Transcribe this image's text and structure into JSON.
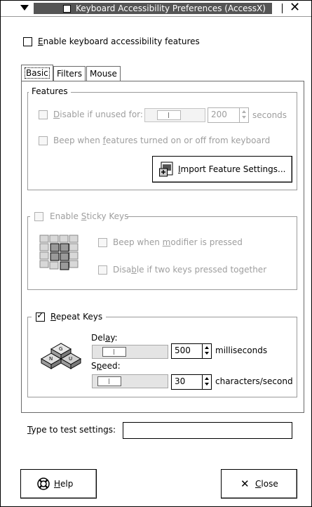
{
  "window": {
    "title": "Keyboard Accessibility Preferences (AccessX)",
    "menu_icon": "window-menu-arrow-icon",
    "close_icon": "close-x-icon"
  },
  "main": {
    "enable_label_mn": "E",
    "enable_label_rest": "nable keyboard accessibility features",
    "enable_checked": false
  },
  "tabs": [
    {
      "label": "Basic",
      "active": true
    },
    {
      "label": "Filters",
      "active": false
    },
    {
      "label": "Mouse",
      "active": false
    }
  ],
  "features": {
    "title": "Features",
    "disable_unused_mn": "D",
    "disable_unused_rest": "isable if unused for:",
    "timeout_value": "200",
    "timeout_unit": "seconds",
    "beep_pre": "Beep when ",
    "beep_mn": "f",
    "beep_post": "eatures turned on or off from keyboard",
    "import_mn": "I",
    "import_rest": "mport Feature Settings...",
    "import_icon": "import-settings-icon"
  },
  "sticky": {
    "title_pre": "Enable ",
    "title_mn": "S",
    "title_post": "ticky Keys",
    "icon": "sticky-keys-icon",
    "beep_pre": "Beep when ",
    "beep_mn": "m",
    "beep_post": "odifier is pressed",
    "disable_pre": "Disa",
    "disable_mn": "b",
    "disable_post": "le if two keys pressed together"
  },
  "repeat": {
    "title_mn": "R",
    "title_rest": "epeat Keys",
    "checked": true,
    "icon": "repeat-keys-icon",
    "delay_pre": "Del",
    "delay_mn": "a",
    "delay_post": "y:",
    "delay_value": "500",
    "delay_unit": "milliseconds",
    "speed_pre": "S",
    "speed_mn": "p",
    "speed_post": "eed:",
    "speed_value": "30",
    "speed_unit": "characters/second"
  },
  "test": {
    "label_mn": "T",
    "label_rest": "ype to test settings:",
    "value": ""
  },
  "buttons": {
    "help_mn": "H",
    "help_rest": "elp",
    "help_icon": "help-lifebuoy-icon",
    "close_mn": "C",
    "close_rest": "lose",
    "close_icon": "close-x-icon"
  }
}
